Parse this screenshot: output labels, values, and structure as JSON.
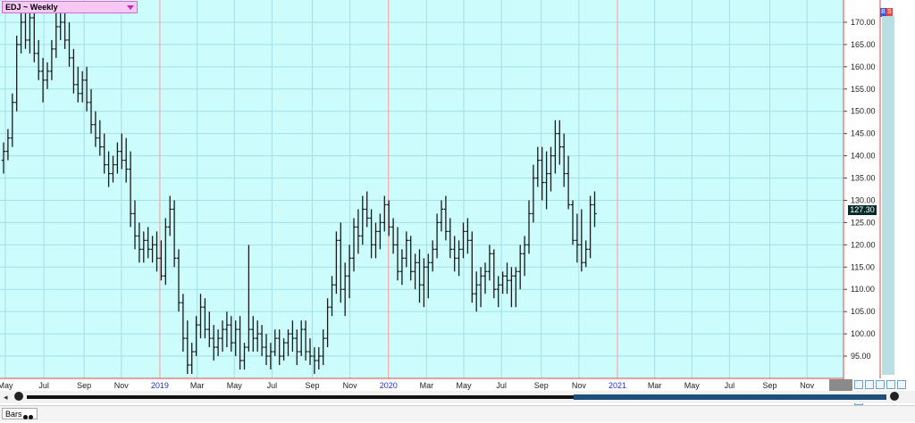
{
  "title": "EDJ ~ Weekly",
  "last_price_label": "127.30",
  "bs_badge": {
    "b": "B",
    "s": "S"
  },
  "bottom_tab": "Bars",
  "colors": {
    "plot_bg": "#ccfcfc",
    "grid": "#a6dfe6",
    "bars": "#1a1a1a",
    "axis_line": "#e04848",
    "year_label": "#2233cc",
    "tab_bg": "#f7c8f4"
  },
  "chart_data": {
    "type": "ohlc",
    "ylim": [
      90,
      175
    ],
    "yticks": [
      95,
      100,
      105,
      110,
      115,
      120,
      125,
      130,
      135,
      140,
      145,
      150,
      155,
      160,
      165,
      170
    ],
    "ytick_labels": [
      "95.00",
      "100.00",
      "105.00",
      "110.00",
      "115.00",
      "120.00",
      "125.00",
      "130.00",
      "135.00",
      "140.00",
      "145.00",
      "150.00",
      "155.00",
      "160.00",
      "165.00",
      "170.00"
    ],
    "x_labels": [
      {
        "label": "May",
        "pos": 0.4,
        "year": false
      },
      {
        "label": "Jul",
        "pos": 9.2,
        "year": false
      },
      {
        "label": "Sep",
        "pos": 18.4,
        "year": false
      },
      {
        "label": "Nov",
        "pos": 26.9,
        "year": false
      },
      {
        "label": "2019",
        "pos": 35.7,
        "year": true
      },
      {
        "label": "Mar",
        "pos": 44.2,
        "year": false
      },
      {
        "label": "May",
        "pos": 52.7,
        "year": false
      },
      {
        "label": "Jul",
        "pos": 61.3,
        "year": false
      },
      {
        "label": "Sep",
        "pos": 70.5,
        "year": false
      },
      {
        "label": "Nov",
        "pos": 79.1,
        "year": false
      },
      {
        "label": "2020",
        "pos": 87.9,
        "year": true
      },
      {
        "label": "Mar",
        "pos": 96.6,
        "year": false
      },
      {
        "label": "May",
        "pos": 105.1,
        "year": false
      },
      {
        "label": "Jul",
        "pos": 113.7,
        "year": false
      },
      {
        "label": "Sep",
        "pos": 122.8,
        "year": false
      },
      {
        "label": "Nov",
        "pos": 131.4,
        "year": false
      },
      {
        "label": "2021",
        "pos": 140.2,
        "year": true
      },
      {
        "label": "Mar",
        "pos": 148.7,
        "year": false
      },
      {
        "label": "May",
        "pos": 157.2,
        "year": false
      },
      {
        "label": "Jul",
        "pos": 165.8,
        "year": false
      },
      {
        "label": "Sep",
        "pos": 175.0,
        "year": false
      },
      {
        "label": "Nov",
        "pos": 183.5,
        "year": false
      }
    ],
    "bars": [
      [
        139,
        143,
        136,
        141
      ],
      [
        141,
        146,
        139,
        144
      ],
      [
        144,
        154,
        142,
        152
      ],
      [
        152,
        167,
        150,
        165
      ],
      [
        165,
        173,
        163,
        170
      ],
      [
        170,
        174,
        164,
        166
      ],
      [
        166,
        172,
        163,
        171
      ],
      [
        171,
        174,
        161,
        163
      ],
      [
        163,
        166,
        157,
        159
      ],
      [
        159,
        162,
        152,
        157
      ],
      [
        157,
        161,
        155,
        159
      ],
      [
        159,
        166,
        157,
        164
      ],
      [
        164,
        172,
        162,
        169
      ],
      [
        169,
        173,
        166,
        170
      ],
      [
        170,
        172,
        164,
        166
      ],
      [
        166,
        170,
        160,
        162
      ],
      [
        162,
        164,
        154,
        156
      ],
      [
        156,
        160,
        152,
        154
      ],
      [
        154,
        159,
        152,
        157
      ],
      [
        157,
        160,
        150,
        152
      ],
      [
        152,
        155,
        145,
        147
      ],
      [
        147,
        150,
        142,
        144
      ],
      [
        144,
        148,
        140,
        142
      ],
      [
        142,
        145,
        136,
        138
      ],
      [
        138,
        141,
        133,
        136
      ],
      [
        136,
        140,
        134,
        138
      ],
      [
        138,
        143,
        136,
        141
      ],
      [
        141,
        145,
        137,
        139
      ],
      [
        139,
        144,
        134,
        137
      ],
      [
        137,
        141,
        124,
        127
      ],
      [
        127,
        130,
        119,
        122
      ],
      [
        122,
        125,
        116,
        119
      ],
      [
        119,
        123,
        116,
        121
      ],
      [
        121,
        124,
        117,
        119
      ],
      [
        119,
        122,
        116,
        120
      ],
      [
        120,
        123,
        114,
        117
      ],
      [
        117,
        121,
        112,
        113
      ],
      [
        113,
        126,
        111,
        124
      ],
      [
        124,
        131,
        122,
        128
      ],
      [
        128,
        130,
        115,
        117
      ],
      [
        117,
        119,
        105,
        107
      ],
      [
        107,
        109,
        96,
        99
      ],
      [
        99,
        103,
        91,
        93
      ],
      [
        93,
        98,
        91,
        96
      ],
      [
        96,
        104,
        95,
        102
      ],
      [
        102,
        109,
        99,
        106
      ],
      [
        106,
        108,
        99,
        101
      ],
      [
        101,
        105,
        97,
        99
      ],
      [
        99,
        102,
        94,
        97
      ],
      [
        97,
        101,
        95,
        99
      ],
      [
        99,
        103,
        96,
        101
      ],
      [
        101,
        105,
        97,
        102
      ],
      [
        102,
        104,
        96,
        98
      ],
      [
        98,
        103,
        95,
        101
      ],
      [
        101,
        104,
        92,
        94
      ],
      [
        94,
        98,
        92,
        97
      ],
      [
        97,
        120,
        96,
        101
      ],
      [
        101,
        104,
        96,
        99
      ],
      [
        99,
        103,
        96,
        100
      ],
      [
        100,
        102,
        95,
        97
      ],
      [
        97,
        100,
        93,
        95
      ],
      [
        95,
        98,
        92,
        96
      ],
      [
        96,
        101,
        95,
        99
      ],
      [
        99,
        101,
        93,
        95
      ],
      [
        95,
        99,
        94,
        98
      ],
      [
        98,
        101,
        95,
        100
      ],
      [
        100,
        103,
        96,
        99
      ],
      [
        99,
        101,
        93,
        96
      ],
      [
        96,
        103,
        95,
        101
      ],
      [
        101,
        103,
        94,
        96
      ],
      [
        96,
        99,
        93,
        95
      ],
      [
        95,
        97,
        91,
        94
      ],
      [
        94,
        97,
        92,
        95
      ],
      [
        95,
        101,
        93,
        99
      ],
      [
        99,
        108,
        97,
        106
      ],
      [
        106,
        113,
        104,
        111
      ],
      [
        111,
        123,
        109,
        121
      ],
      [
        121,
        125,
        107,
        110
      ],
      [
        110,
        116,
        104,
        113
      ],
      [
        113,
        120,
        108,
        117
      ],
      [
        117,
        126,
        114,
        124
      ],
      [
        124,
        128,
        118,
        122
      ],
      [
        122,
        131,
        120,
        128
      ],
      [
        128,
        132,
        124,
        126
      ],
      [
        126,
        128,
        117,
        120
      ],
      [
        120,
        125,
        117,
        123
      ],
      [
        123,
        127,
        119,
        125
      ],
      [
        125,
        131,
        123,
        129
      ],
      [
        129,
        130,
        122,
        124
      ],
      [
        124,
        126,
        118,
        120
      ],
      [
        120,
        124,
        112,
        114
      ],
      [
        114,
        119,
        111,
        117
      ],
      [
        117,
        123,
        115,
        121
      ],
      [
        121,
        122,
        112,
        114
      ],
      [
        114,
        118,
        110,
        116
      ],
      [
        116,
        119,
        107,
        111
      ],
      [
        111,
        117,
        106,
        115
      ],
      [
        115,
        118,
        108,
        116
      ],
      [
        116,
        121,
        114,
        119
      ],
      [
        119,
        127,
        117,
        125
      ],
      [
        125,
        130,
        123,
        128
      ],
      [
        128,
        131,
        121,
        123
      ],
      [
        123,
        126,
        117,
        119
      ],
      [
        119,
        122,
        114,
        117
      ],
      [
        117,
        121,
        113,
        119
      ],
      [
        119,
        125,
        117,
        123
      ],
      [
        123,
        126,
        118,
        121
      ],
      [
        121,
        123,
        107,
        109
      ],
      [
        109,
        114,
        105,
        111
      ],
      [
        111,
        115,
        106,
        113
      ],
      [
        113,
        116,
        109,
        114
      ],
      [
        114,
        120,
        112,
        118
      ],
      [
        118,
        119,
        108,
        110
      ],
      [
        110,
        113,
        106,
        111
      ],
      [
        111,
        114,
        109,
        113
      ],
      [
        113,
        116,
        109,
        112
      ],
      [
        112,
        115,
        106,
        113
      ],
      [
        113,
        115,
        106,
        114
      ],
      [
        114,
        120,
        110,
        118
      ],
      [
        118,
        122,
        113,
        120
      ],
      [
        120,
        130,
        118,
        127
      ],
      [
        127,
        138,
        125,
        135
      ],
      [
        135,
        142,
        133,
        139
      ],
      [
        139,
        142,
        130,
        134
      ],
      [
        134,
        141,
        128,
        136
      ],
      [
        136,
        142,
        132,
        140
      ],
      [
        140,
        148,
        136,
        145
      ],
      [
        145,
        148,
        138,
        142
      ],
      [
        142,
        145,
        133,
        136
      ],
      [
        136,
        140,
        128,
        129
      ],
      [
        129,
        130,
        120,
        121
      ],
      [
        121,
        127,
        116,
        120
      ],
      [
        120,
        128,
        114,
        116
      ],
      [
        116,
        121,
        115,
        119
      ],
      [
        119,
        131,
        117,
        129
      ],
      [
        129,
        132,
        124,
        127
      ]
    ]
  }
}
